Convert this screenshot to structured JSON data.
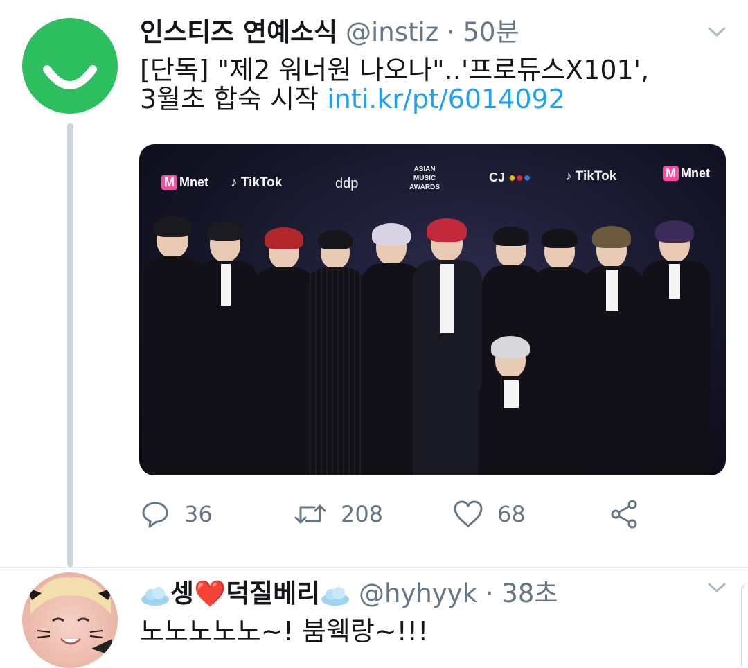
{
  "tweets": [
    {
      "display_name": "인스티즈 연예소식",
      "handle": "@instiz",
      "separator": "·",
      "time": "50분",
      "text_line1": "[단독] \"제2 워너원 나오나\"..'프로듀스X101',",
      "text_line2": "3월초 합숙 시작",
      "link": "inti.kr/pt/6014092",
      "avatar_icon": "instiz-smile-logo",
      "media": {
        "backdrop_logos": [
          "Mnet",
          "TikTok",
          "ddp",
          "ASIAN MUSIC AWARDS",
          "CJ",
          "TikTok",
          "Mnet"
        ]
      },
      "actions": {
        "reply_icon": "reply-icon",
        "reply_count": "36",
        "retweet_icon": "retweet-icon",
        "retweet_count": "208",
        "like_icon": "heart-icon",
        "like_count": "68",
        "share_icon": "share-icon"
      }
    },
    {
      "display_name": "셍❤️덕질베리",
      "handle": "@hyhyyk",
      "separator": "·",
      "time": "38초",
      "text": "노노노노노~! 붐웩랑~!!!",
      "name_emoji": "cloud-icon"
    }
  ],
  "colors": {
    "link": "#1da1f2",
    "secondary_text": "#657786",
    "thread_line": "#ccd6dd",
    "instiz_green": "#2dbe60"
  }
}
